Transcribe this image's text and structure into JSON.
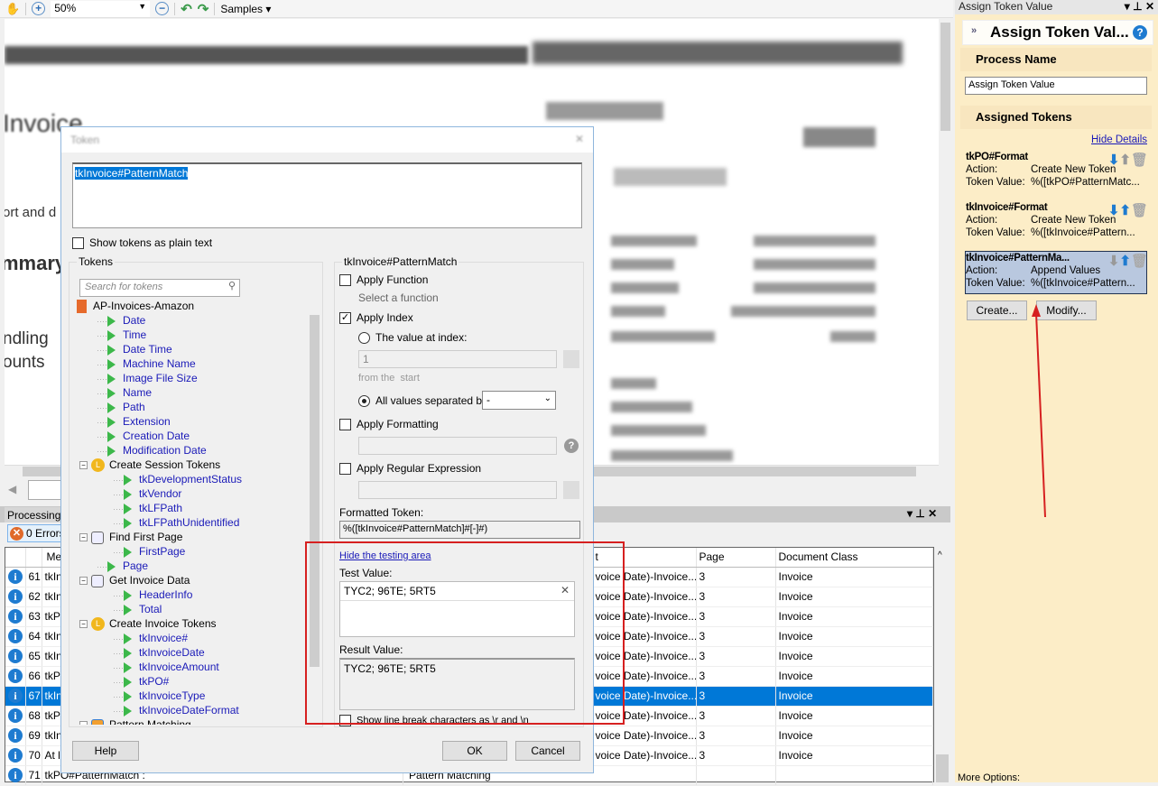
{
  "toolbar": {
    "zoom": "50%",
    "samples": "Samples",
    "icons": [
      "hand-icon",
      "zoom-in-icon",
      "zoom-out-icon",
      "undo-icon",
      "redo-icon"
    ]
  },
  "document": {
    "partial_texts": [
      "Invoice",
      "ort and d",
      "mmary",
      "ndling",
      "ounts"
    ]
  },
  "processing": {
    "tab": "Processing",
    "errors": "0 Errors",
    "columns": [
      "",
      "",
      "Me",
      "t",
      "Page",
      "Document Class"
    ],
    "rows": [
      {
        "n": "61",
        "msg": "tkIn",
        "out": "voice Date)-Invoice...",
        "page": "3",
        "cls": "Invoice"
      },
      {
        "n": "62",
        "msg": "tkIn",
        "out": "voice Date)-Invoice...",
        "page": "3",
        "cls": "Invoice"
      },
      {
        "n": "63",
        "msg": "tkP",
        "out": "voice Date)-Invoice...",
        "page": "3",
        "cls": "Invoice"
      },
      {
        "n": "64",
        "msg": "tkIn",
        "out": "voice Date)-Invoice...",
        "page": "3",
        "cls": "Invoice"
      },
      {
        "n": "65",
        "msg": "tkIn",
        "out": "voice Date)-Invoice...",
        "page": "3",
        "cls": "Invoice"
      },
      {
        "n": "66",
        "msg": "tkP",
        "out": "voice Date)-Invoice...",
        "page": "3",
        "cls": "Invoice"
      },
      {
        "n": "67",
        "msg": "tkIn",
        "out": "voice Date)-Invoice...",
        "page": "3",
        "cls": "Invoice",
        "selected": true
      },
      {
        "n": "68",
        "msg": "tkP",
        "out": "voice Date)-Invoice...",
        "page": "3",
        "cls": "Invoice"
      },
      {
        "n": "69",
        "msg": "tkIn",
        "out": "voice Date)-Invoice...",
        "page": "3",
        "cls": "Invoice"
      },
      {
        "n": "70",
        "msg": "At le",
        "out": "voice Date)-Invoice...",
        "page": "3",
        "cls": "Invoice"
      },
      {
        "n": "71",
        "msg": "tkPO#PatternMatch :",
        "activity": "Pattern Matching",
        "out": "",
        "page": "",
        "cls": ""
      }
    ]
  },
  "right_panel": {
    "title": "Assign Token Value",
    "header": "Assign Token Val...",
    "process_name_label": "Process Name",
    "process_name": "Assign Token Value",
    "assigned_label": "Assigned Tokens",
    "hide_details": "Hide Details",
    "action_label": "Action:",
    "value_label": "Token Value:",
    "tokens": [
      {
        "name": "tkPO#Format",
        "action": "Create New Token",
        "value": "%([tkPO#PatternMatc..."
      },
      {
        "name": "tkInvoice#Format",
        "action": "Create New Token",
        "value": "%([tkInvoice#Pattern..."
      },
      {
        "name": "tkInvoice#PatternMa...",
        "action": "Append Values",
        "value": "%([tkInvoice#Pattern...",
        "selected": true
      }
    ],
    "create": "Create...",
    "modify": "Modify...",
    "more_options": "More Options:"
  },
  "dialog": {
    "title": "Token",
    "expression": "tkInvoice#PatternMatch",
    "plain_text": "Show tokens as plain text",
    "tokens_label": "Tokens",
    "search_placeholder": "Search for tokens",
    "tree": [
      {
        "t": "root",
        "label": "AP-Invoices-Amazon"
      },
      {
        "t": "leaf",
        "d": 1,
        "label": "Date"
      },
      {
        "t": "leaf",
        "d": 1,
        "label": "Time"
      },
      {
        "t": "leaf",
        "d": 1,
        "label": "Date Time"
      },
      {
        "t": "leaf",
        "d": 1,
        "label": "Machine Name"
      },
      {
        "t": "leaf",
        "d": 1,
        "label": "Image File Size"
      },
      {
        "t": "leaf",
        "d": 1,
        "label": "Name"
      },
      {
        "t": "leaf",
        "d": 1,
        "label": "Path"
      },
      {
        "t": "leaf",
        "d": 1,
        "label": "Extension"
      },
      {
        "t": "leaf",
        "d": 1,
        "label": "Creation Date"
      },
      {
        "t": "leaf",
        "d": 1,
        "label": "Modification Date"
      },
      {
        "t": "clock",
        "label": "Create Session Tokens"
      },
      {
        "t": "leaf",
        "d": 2,
        "label": "tkDevelopmentStatus"
      },
      {
        "t": "leaf",
        "d": 2,
        "label": "tkVendor"
      },
      {
        "t": "leaf",
        "d": 2,
        "label": "tkLFPath"
      },
      {
        "t": "leaf",
        "d": 2,
        "label": "tkLFPathUnidentified"
      },
      {
        "t": "gear",
        "label": "Find First Page"
      },
      {
        "t": "leaf",
        "d": 2,
        "label": "FirstPage"
      },
      {
        "t": "leaf",
        "d": 1,
        "label": "Page"
      },
      {
        "t": "gear",
        "label": "Get Invoice Data"
      },
      {
        "t": "leaf",
        "d": 2,
        "label": "HeaderInfo"
      },
      {
        "t": "leaf",
        "d": 2,
        "label": "Total"
      },
      {
        "t": "clock",
        "label": "Create Invoice Tokens"
      },
      {
        "t": "leaf",
        "d": 2,
        "label": "tkInvoice#"
      },
      {
        "t": "leaf",
        "d": 2,
        "label": "tkInvoiceDate"
      },
      {
        "t": "leaf",
        "d": 2,
        "label": "tkInvoiceAmount"
      },
      {
        "t": "leaf",
        "d": 2,
        "label": "tkPO#"
      },
      {
        "t": "leaf",
        "d": 2,
        "label": "tkInvoiceType"
      },
      {
        "t": "leaf",
        "d": 2,
        "label": "tkInvoiceDateFormat"
      },
      {
        "t": "pm",
        "label": "Pattern Matching"
      }
    ],
    "options_title": "tkInvoice#PatternMatch",
    "apply_function": "Apply Function",
    "select_function": "Select a function",
    "apply_index": "Apply Index",
    "value_at_index": "The value at index:",
    "index_value": "1",
    "from_the": "from the",
    "start": "start",
    "all_values": "All values separated by:",
    "separator": "-",
    "apply_formatting": "Apply Formatting",
    "apply_regex": "Apply Regular Expression",
    "formatted_token_label": "Formatted Token:",
    "formatted_token": "%([tkInvoice#PatternMatch]#[-]#)",
    "hide_testing": "Hide the testing area",
    "test_value_label": "Test Value:",
    "test_value": "TYC2; 96TE; 5RT5",
    "result_label": "Result Value:",
    "result_value": "TYC2; 96TE; 5RT5",
    "line_breaks": "Show line break characters as \\r and \\n",
    "help": "Help",
    "ok": "OK",
    "cancel": "Cancel"
  },
  "colors": {
    "accent": "#0078d7",
    "annotation": "#d62020",
    "panel": "#fcedc7"
  }
}
